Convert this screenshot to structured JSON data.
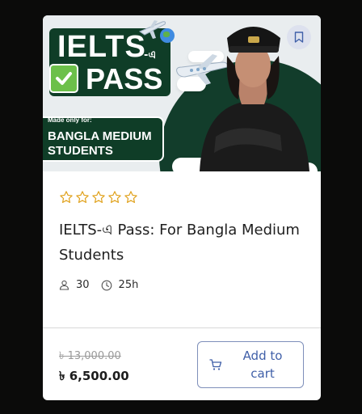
{
  "banner": {
    "title_line1": "IELTS",
    "title_suffix": "-এ",
    "title_line2": "PASS",
    "made_label": "Made only for:",
    "made_title": "BANGLA MEDIUM STUDENTS",
    "colors": {
      "dark_green": "#0f3d27",
      "check_green": "#6cc04a",
      "bg": "#e9edef"
    }
  },
  "bookmark": {
    "icon": "bookmark-icon"
  },
  "rating": {
    "stars_filled": 0,
    "stars_total": 5,
    "star_color": "#e0a11b"
  },
  "course": {
    "title": "IELTS-এ Pass: For Bangla Medium Students"
  },
  "meta": {
    "students": "30",
    "duration": "25h",
    "student_icon": "user-icon",
    "duration_icon": "clock-icon"
  },
  "pricing": {
    "old_price": "৳ 13,000.00",
    "price": "৳ 6,500.00"
  },
  "cart": {
    "label": "Add to cart",
    "icon": "cart-icon",
    "color": "#3f5fa8"
  }
}
